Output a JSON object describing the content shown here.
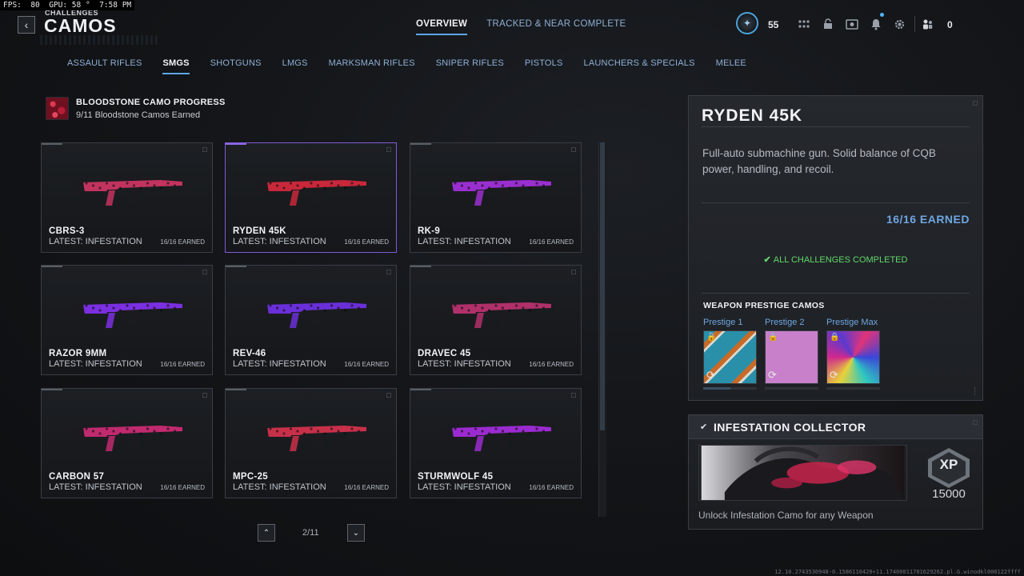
{
  "hud": {
    "fps_text": "FPS:  80  GPU: 58 °  7:58 PM"
  },
  "header": {
    "breadcrumb": "CHALLENGES",
    "title": "CAMOS",
    "back_glyph": "‹",
    "tabs": [
      {
        "label": "OVERVIEW",
        "active": true
      },
      {
        "label": "TRACKED & NEAR COMPLETE",
        "active": false
      }
    ],
    "player_level": "55",
    "party_count": "0"
  },
  "categories": [
    {
      "label": "ASSAULT RIFLES",
      "active": false
    },
    {
      "label": "SMGS",
      "active": true
    },
    {
      "label": "SHOTGUNS",
      "active": false
    },
    {
      "label": "LMGS",
      "active": false
    },
    {
      "label": "MARKSMAN RIFLES",
      "active": false
    },
    {
      "label": "SNIPER RIFLES",
      "active": false
    },
    {
      "label": "PISTOLS",
      "active": false
    },
    {
      "label": "LAUNCHERS & SPECIALS",
      "active": false
    },
    {
      "label": "MELEE",
      "active": false
    }
  ],
  "bloodstone": {
    "title": "BLOODSTONE CAMO PROGRESS",
    "subtitle": "9/11 Bloodstone Camos Earned"
  },
  "weapons": [
    {
      "name": "CBRS-3",
      "latest": "LATEST: INFESTATION",
      "earned": "16/16 EARNED",
      "camo": "#c2335f",
      "selected": false
    },
    {
      "name": "RYDEN 45K",
      "latest": "LATEST: INFESTATION",
      "earned": "16/16 EARNED",
      "camo": "#c8283a",
      "selected": true
    },
    {
      "name": "RK-9",
      "latest": "LATEST: INFESTATION",
      "earned": "16/16 EARNED",
      "camo": "#9a2fd0",
      "selected": false
    },
    {
      "name": "RAZOR 9MM",
      "latest": "LATEST: INFESTATION",
      "earned": "16/16 EARNED",
      "camo": "#7b2fe0",
      "selected": false
    },
    {
      "name": "REV-46",
      "latest": "LATEST: INFESTATION",
      "earned": "16/16 EARNED",
      "camo": "#6a2fd8",
      "selected": false
    },
    {
      "name": "DRAVEC 45",
      "latest": "LATEST: INFESTATION",
      "earned": "16/16 EARNED",
      "camo": "#b0306a",
      "selected": false
    },
    {
      "name": "CARBON 57",
      "latest": "LATEST: INFESTATION",
      "earned": "16/16 EARNED",
      "camo": "#c02a6e",
      "selected": false
    },
    {
      "name": "MPC-25",
      "latest": "LATEST: INFESTATION",
      "earned": "16/16 EARNED",
      "camo": "#c8304a",
      "selected": false
    },
    {
      "name": "STURMWOLF 45",
      "latest": "LATEST: INFESTATION",
      "earned": "16/16 EARNED",
      "camo": "#9b2bd0",
      "selected": false
    }
  ],
  "pager": {
    "text": "2/11",
    "prev_glyph": "⌃",
    "next_glyph": "⌄"
  },
  "detail": {
    "name": "RYDEN 45K",
    "description": "Full-auto submachine gun. Solid balance of CQB power, handling, and recoil.",
    "earned": "16/16 EARNED",
    "complete": "ALL CHALLENGES COMPLETED",
    "prestige_title": "WEAPON PRESTIGE CAMOS",
    "prestige": [
      {
        "label": "Prestige 1"
      },
      {
        "label": "Prestige 2"
      },
      {
        "label": "Prestige Max"
      }
    ]
  },
  "challenge": {
    "title": "INFESTATION COLLECTOR",
    "xp_label": "XP",
    "xp": "15000",
    "description": "Unlock Infestation Camo for any Weapon"
  },
  "footer": {
    "build": "12.10.2743530948-0.1586110420+11.17400011781629262.pl.G.winodkl000122ffff"
  }
}
